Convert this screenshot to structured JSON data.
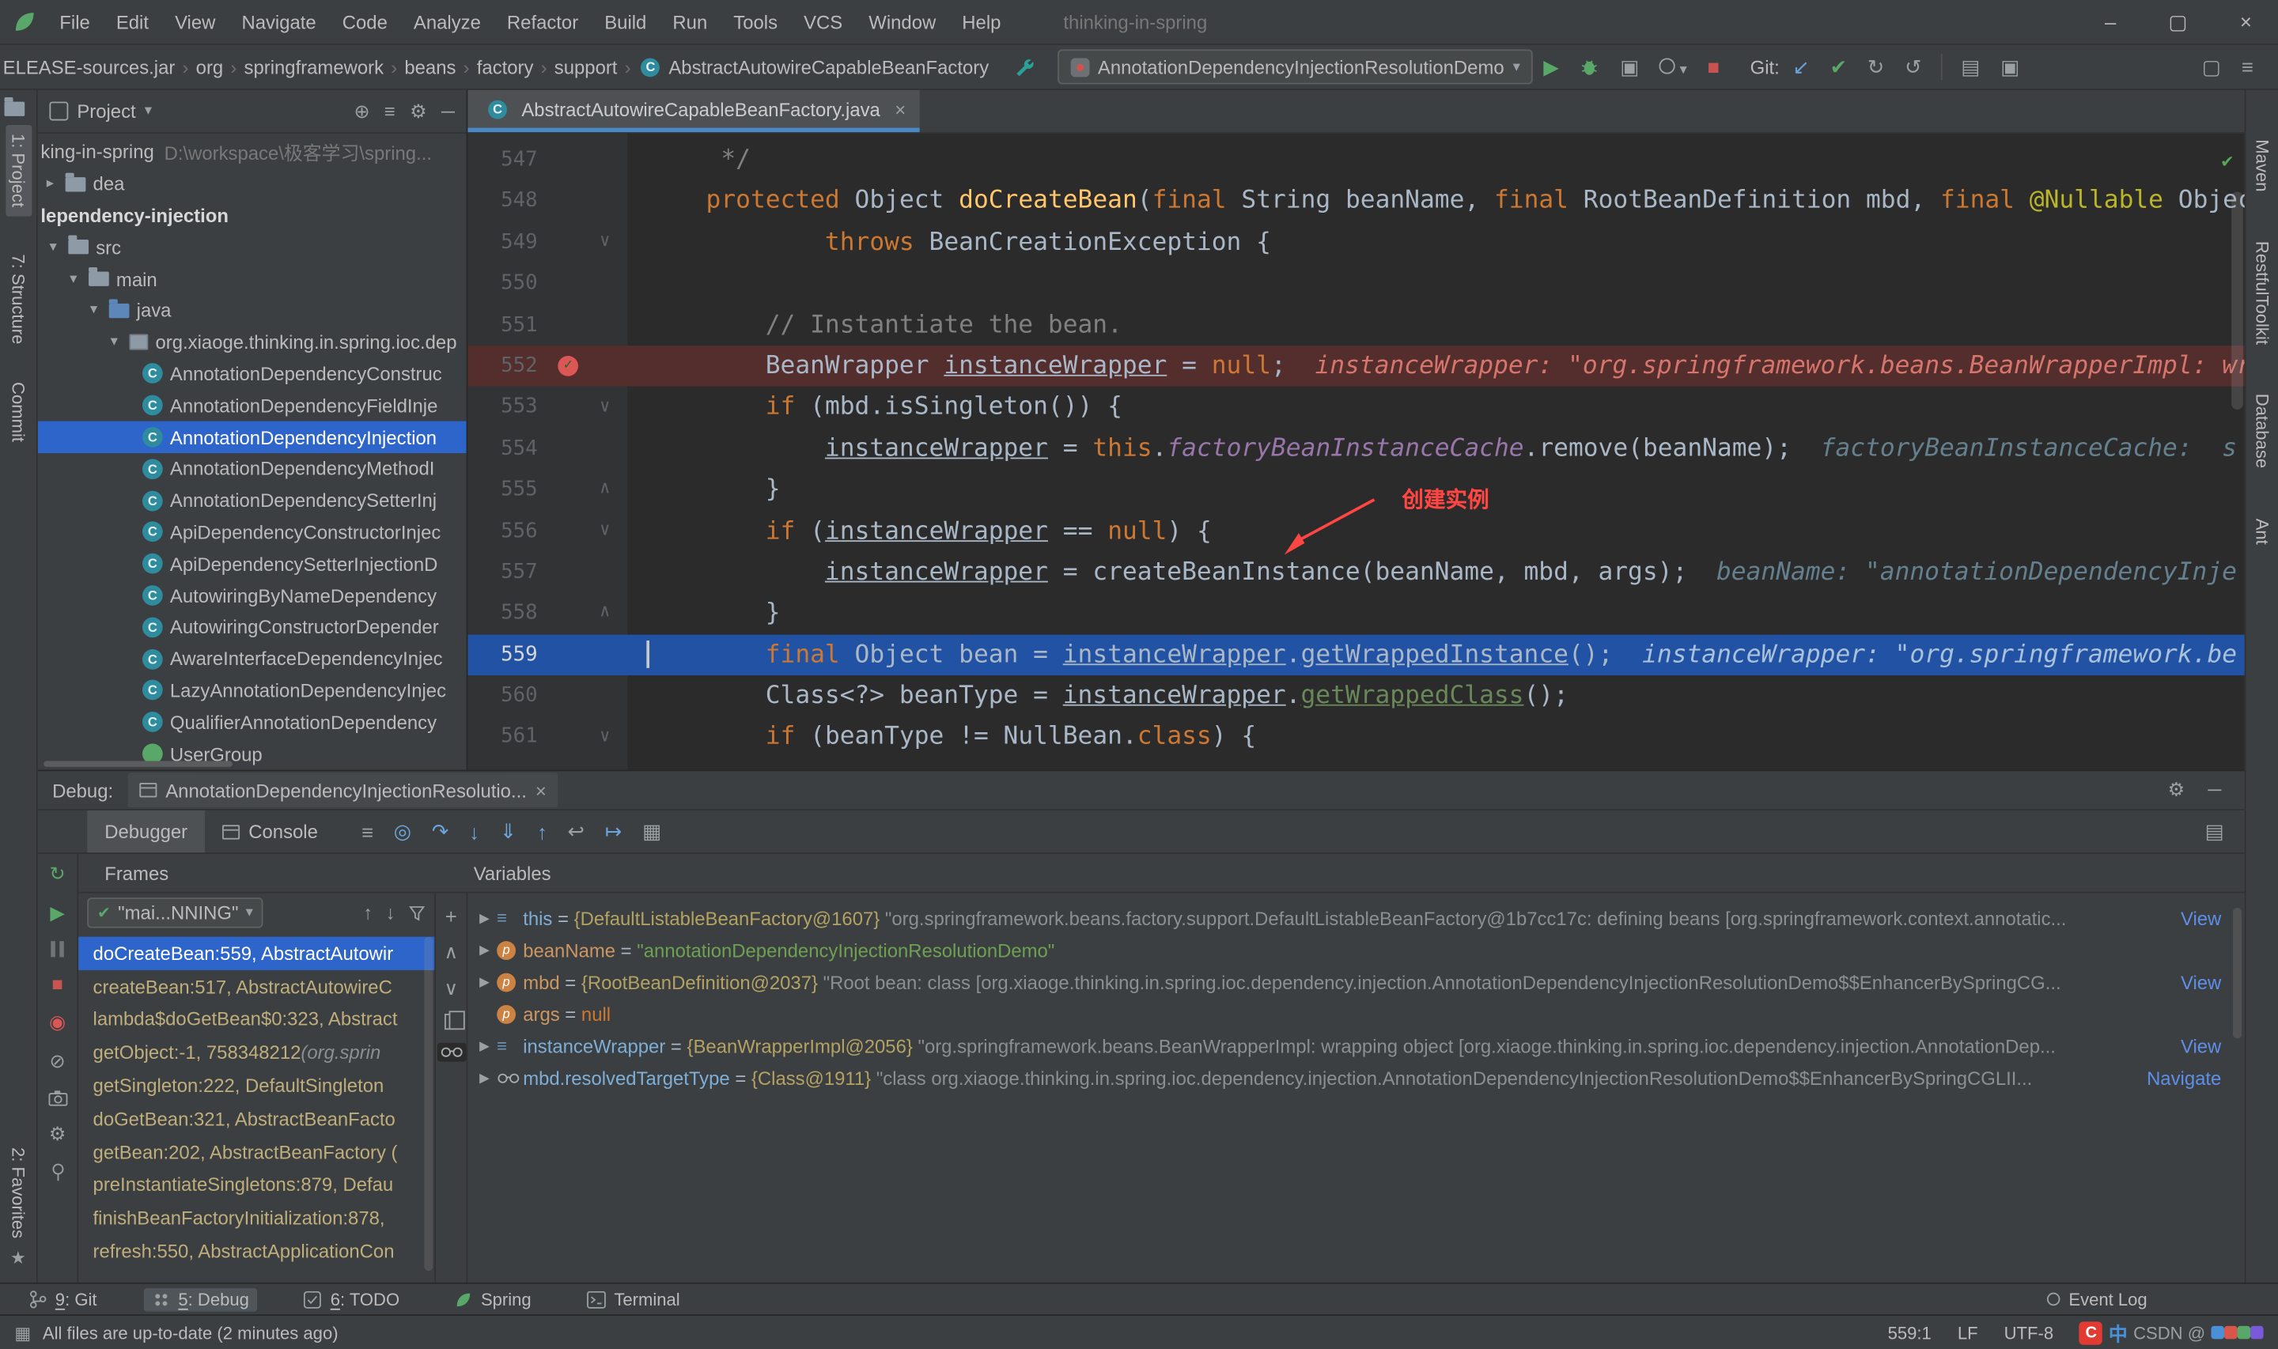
{
  "window": {
    "title": "thinking-in-spring",
    "controls": {
      "minimize": "–",
      "maximize": "▢",
      "close": "×"
    }
  },
  "menu": [
    "File",
    "Edit",
    "View",
    "Navigate",
    "Code",
    "Analyze",
    "Refactor",
    "Build",
    "Run",
    "Tools",
    "VCS",
    "Window",
    "Help"
  ],
  "navbar": {
    "breadcrumbs": [
      "ELEASE-sources.jar",
      "org",
      "springframework",
      "beans",
      "factory",
      "support",
      "AbstractAutowireCapableBeanFactory"
    ],
    "run_config": "AnnotationDependencyInjectionResolutionDemo",
    "git_label": "Git:"
  },
  "left_stripe": {
    "top": [
      "1: Project",
      "7: Structure",
      "Commit"
    ],
    "bottom": [
      "2: Favorites"
    ]
  },
  "right_stripe": [
    "Maven",
    "RestfulToolkit",
    "Database",
    "Ant"
  ],
  "project_panel": {
    "title": "Project",
    "tree": [
      {
        "label": "king-in-spring",
        "suffix": "D:\\workspace\\极客学习\\spring...",
        "pad": 2
      },
      {
        "label": "dea",
        "icon": "folder",
        "pad": 6,
        "chevron": "right"
      },
      {
        "label": "lependency-injection",
        "pad": 2,
        "bold": true
      },
      {
        "label": "src",
        "icon": "folder",
        "pad": 8,
        "chevron": "down"
      },
      {
        "label": "main",
        "icon": "folder",
        "pad": 22,
        "chevron": "down"
      },
      {
        "label": "java",
        "icon": "source-folder",
        "pad": 36,
        "chevron": "down"
      },
      {
        "label": "org.xiaoge.thinking.in.spring.ioc.dep",
        "icon": "package",
        "pad": 50,
        "chevron": "down"
      },
      {
        "label": "AnnotationDependencyConstruc",
        "icon": "class",
        "pad": 72
      },
      {
        "label": "AnnotationDependencyFieldInje",
        "icon": "class",
        "pad": 72
      },
      {
        "label": "AnnotationDependencyInjection",
        "icon": "class",
        "pad": 72,
        "selected": true
      },
      {
        "label": "AnnotationDependencyMethodI",
        "icon": "class",
        "pad": 72
      },
      {
        "label": "AnnotationDependencySetterInj",
        "icon": "class",
        "pad": 72
      },
      {
        "label": "ApiDependencyConstructorInjec",
        "icon": "class",
        "pad": 72
      },
      {
        "label": "ApiDependencySetterInjectionD",
        "icon": "class",
        "pad": 72
      },
      {
        "label": "AutowiringByNameDependency",
        "icon": "class",
        "pad": 72
      },
      {
        "label": "AutowiringConstructorDepender",
        "icon": "class",
        "pad": 72
      },
      {
        "label": "AwareInterfaceDependencyInjec",
        "icon": "class",
        "pad": 72
      },
      {
        "label": "LazyAnnotationDependencyInjec",
        "icon": "class",
        "pad": 72
      },
      {
        "label": "QualifierAnnotationDependency",
        "icon": "class",
        "pad": 72
      },
      {
        "label": "UserGroup",
        "icon": "class-green",
        "pad": 72
      }
    ]
  },
  "editor": {
    "tab": "AbstractAutowireCapableBeanFactory.java",
    "annotation": "创建实例",
    "lines": [
      {
        "num": 547,
        "tokens": [
          [
            "     */",
            "c"
          ]
        ]
      },
      {
        "num": 548,
        "tokens": [
          [
            "    ",
            "p"
          ],
          [
            "protected ",
            "kw"
          ],
          [
            "Object ",
            "p"
          ],
          [
            "doCreateBean",
            "m"
          ],
          [
            "(",
            "p"
          ],
          [
            "final ",
            "kw"
          ],
          [
            "String beanName, ",
            "p"
          ],
          [
            "final ",
            "kw"
          ],
          [
            "RootBeanDefinition mbd, ",
            "p"
          ],
          [
            "final ",
            "kw"
          ],
          [
            "@Nullable",
            "ann"
          ],
          [
            " Object[] a",
            "p"
          ]
        ]
      },
      {
        "num": 549,
        "tokens": [
          [
            "            ",
            "p"
          ],
          [
            "throws ",
            "kw"
          ],
          [
            "BeanCreationException {",
            "p"
          ]
        ],
        "fold": "v"
      },
      {
        "num": 550,
        "tokens": []
      },
      {
        "num": 551,
        "tokens": [
          [
            "        ",
            "p"
          ],
          [
            "// Instantiate the bean.",
            "c"
          ]
        ]
      },
      {
        "num": 552,
        "bg": "bp",
        "bp": true,
        "tokens": [
          [
            "        BeanWrapper ",
            "p"
          ],
          [
            "instanceWrapper",
            "u"
          ],
          [
            " = ",
            "p"
          ],
          [
            "null",
            "kw"
          ],
          [
            ";",
            "p"
          ]
        ],
        "hint": "instanceWrapper: \"org.springframework.beans.BeanWrapperImpl: wr",
        "hs": "changed"
      },
      {
        "num": 553,
        "tokens": [
          [
            "        ",
            "p"
          ],
          [
            "if",
            "kw"
          ],
          [
            " (mbd.isSingleton()) {",
            "p"
          ]
        ],
        "fold": "v"
      },
      {
        "num": 554,
        "tokens": [
          [
            "            ",
            "p"
          ],
          [
            "instanceWrapper",
            "u"
          ],
          [
            " = ",
            "p"
          ],
          [
            "this",
            "kw"
          ],
          [
            ".",
            "p"
          ],
          [
            "factoryBeanInstanceCache",
            "f"
          ],
          [
            ".remove(beanName);",
            "p"
          ]
        ],
        "hint": "factoryBeanInstanceCache:  s",
        "hs": "normal"
      },
      {
        "num": 555,
        "tokens": [
          [
            "        }",
            "p"
          ]
        ],
        "fold": "^"
      },
      {
        "num": 556,
        "tokens": [
          [
            "        ",
            "p"
          ],
          [
            "if",
            "kw"
          ],
          [
            " (",
            "p"
          ],
          [
            "instanceWrapper",
            "u"
          ],
          [
            " == ",
            "p"
          ],
          [
            "null",
            "kw"
          ],
          [
            ") {",
            "p"
          ]
        ],
        "fold": "v"
      },
      {
        "num": 557,
        "tokens": [
          [
            "            ",
            "p"
          ],
          [
            "instanceWrapper",
            "u"
          ],
          [
            " = createBeanInstance(beanName, mbd, args);",
            "p"
          ]
        ],
        "hint": "beanName: \"annotationDependencyInje",
        "hs": "normal"
      },
      {
        "num": 558,
        "tokens": [
          [
            "        }",
            "p"
          ]
        ],
        "fold": "^"
      },
      {
        "num": 559,
        "bg": "exec",
        "caret": true,
        "tokens": [
          [
            "        ",
            "p"
          ],
          [
            "final ",
            "kw"
          ],
          [
            "Object bean = ",
            "p"
          ],
          [
            "instanceWrapper",
            "u"
          ],
          [
            ".",
            "p"
          ],
          [
            "getWrappedInstance",
            "u"
          ],
          [
            "();",
            "p"
          ]
        ],
        "hint": "instanceWrapper: \"org.springframework.be",
        "hs": "exec"
      },
      {
        "num": 560,
        "tokens": [
          [
            "        Class<?> beanType = ",
            "p"
          ],
          [
            "instanceWrapper",
            "u"
          ],
          [
            ".",
            "p"
          ],
          [
            "getWrappedClass",
            "g"
          ],
          [
            "();",
            "p"
          ]
        ]
      },
      {
        "num": 561,
        "tokens": [
          [
            "        ",
            "p"
          ],
          [
            "if",
            "kw"
          ],
          [
            " (beanType != NullBean.",
            "p"
          ],
          [
            "class",
            "kw"
          ],
          [
            ") {",
            "p"
          ]
        ],
        "fold": "v"
      }
    ]
  },
  "debug_panel": {
    "label": "Debug:",
    "session_tab": "AnnotationDependencyInjectionResolutio...",
    "tabs": [
      "Debugger",
      "Console"
    ],
    "frames": {
      "header": "Frames",
      "thread": "\"mai...NNING\"",
      "items": [
        {
          "text": "doCreateBean:559, AbstractAutowir",
          "selected": true
        },
        {
          "text": "createBean:517, AbstractAutowireC"
        },
        {
          "text": "lambda$doGetBean$0:323, Abstract"
        },
        {
          "text": "getObject:-1, 758348212 ",
          "extra": "(org.sprin"
        },
        {
          "text": "getSingleton:222, DefaultSingleton"
        },
        {
          "text": "doGetBean:321, AbstractBeanFacto"
        },
        {
          "text": "getBean:202, AbstractBeanFactory ("
        },
        {
          "text": "preInstantiateSingletons:879, Defau"
        },
        {
          "text": "finishBeanFactoryInitialization:878,"
        },
        {
          "text": "refresh:550, AbstractApplicationCon"
        }
      ]
    },
    "variables": {
      "header": "Variables",
      "rows": [
        {
          "icon": "value",
          "expand": true,
          "segs": [
            [
              "this",
              "n"
            ],
            [
              " = ",
              "p"
            ],
            [
              "{DefaultListableBeanFactory@1607} ",
              "r"
            ],
            [
              "\"org.springframework.beans.factory.support.DefaultListableBeanFactory@1b7cc17c: defining beans [org.springframework.context.annotatic...",
              "g"
            ]
          ],
          "link": "View"
        },
        {
          "icon": "param",
          "expand": true,
          "segs": [
            [
              "beanName",
              "np"
            ],
            [
              " = ",
              "p"
            ],
            [
              "\"annotationDependencyInjectionResolutionDemo\"",
              "s"
            ]
          ]
        },
        {
          "icon": "param",
          "expand": true,
          "segs": [
            [
              "mbd",
              "np"
            ],
            [
              " = ",
              "p"
            ],
            [
              "{RootBeanDefinition@2037} ",
              "r"
            ],
            [
              "\"Root bean: class [org.xiaoge.thinking.in.spring.ioc.dependency.injection.AnnotationDependencyInjectionResolutionDemo$$EnhancerBySpringCG...",
              "g"
            ]
          ],
          "link": "View"
        },
        {
          "icon": "param",
          "expand": false,
          "segs": [
            [
              "args",
              "np"
            ],
            [
              " = ",
              "p"
            ],
            [
              "null",
              "k"
            ]
          ]
        },
        {
          "icon": "value",
          "expand": true,
          "segs": [
            [
              "instanceWrapper",
              "n"
            ],
            [
              " = ",
              "p"
            ],
            [
              "{BeanWrapperImpl@2056} ",
              "r"
            ],
            [
              "\"org.springframework.beans.BeanWrapperImpl: wrapping object [org.xiaoge.thinking.in.spring.ioc.dependency.injection.AnnotationDep...",
              "g"
            ]
          ],
          "link": "View"
        },
        {
          "icon": "watch",
          "expand": true,
          "segs": [
            [
              "mbd.resolvedTargetType",
              "n"
            ],
            [
              " = ",
              "p"
            ],
            [
              "{Class@1911} ",
              "r"
            ],
            [
              "\"class org.xiaoge.thinking.in.spring.ioc.dependency.injection.AnnotationDependencyInjectionResolutionDemo$$EnhancerBySpringCGLII...",
              "g"
            ]
          ],
          "link": "Navigate"
        }
      ]
    }
  },
  "bottom_bar": {
    "left": [
      {
        "label": "9: Git",
        "icon": "git-branch",
        "mnemonic": true
      },
      {
        "label": "5: Debug",
        "icon": "debug",
        "mnemonic": true,
        "active": true
      },
      {
        "label": "6: TODO",
        "icon": "todo",
        "mnemonic": true
      },
      {
        "label": "Spring",
        "icon": "spring-leaf"
      },
      {
        "label": "Terminal",
        "icon": "terminal"
      }
    ],
    "right": "Event Log"
  },
  "status_bar": {
    "message": "All files are up-to-date (2 minutes ago)",
    "caret": "559:1",
    "line_sep": "LF",
    "encoding": "UTF-8",
    "watermark": {
      "brand": "C",
      "char": "中",
      "handle": "CSDN @",
      "colors": [
        "#4a90d9",
        "#d9574a",
        "#59a869",
        "#7a5ad9"
      ]
    }
  }
}
